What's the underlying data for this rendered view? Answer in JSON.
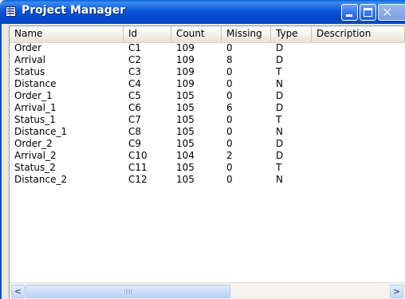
{
  "window": {
    "title": "Project Manager",
    "icon": "grid-window-icon",
    "buttons": {
      "minimize": "minimize-icon",
      "maximize": "maximize-icon",
      "close": "close-icon"
    },
    "accent_color": "#0b55d6"
  },
  "table": {
    "columns": [
      "Name",
      "Id",
      "Count",
      "Missing",
      "Type",
      "Description"
    ],
    "rows": [
      [
        "Order",
        "C1",
        "109",
        "0",
        "D",
        ""
      ],
      [
        "Arrival",
        "C2",
        "109",
        "8",
        "D",
        ""
      ],
      [
        "Status",
        "C3",
        "109",
        "0",
        "T",
        ""
      ],
      [
        "Distance",
        "C4",
        "109",
        "0",
        "N",
        ""
      ],
      [
        "Order_1",
        "C5",
        "105",
        "0",
        "D",
        ""
      ],
      [
        "Arrival_1",
        "C6",
        "105",
        "6",
        "D",
        ""
      ],
      [
        "Status_1",
        "C7",
        "105",
        "0",
        "T",
        ""
      ],
      [
        "Distance_1",
        "C8",
        "105",
        "0",
        "N",
        ""
      ],
      [
        "Order_2",
        "C9",
        "105",
        "0",
        "D",
        ""
      ],
      [
        "Arrival_2",
        "C10",
        "104",
        "2",
        "D",
        ""
      ],
      [
        "Status_2",
        "C11",
        "105",
        "0",
        "T",
        ""
      ],
      [
        "Distance_2",
        "C12",
        "105",
        "0",
        "N",
        ""
      ]
    ]
  },
  "scrollbar": {
    "left_arrow": "<",
    "right_arrow": ">"
  }
}
